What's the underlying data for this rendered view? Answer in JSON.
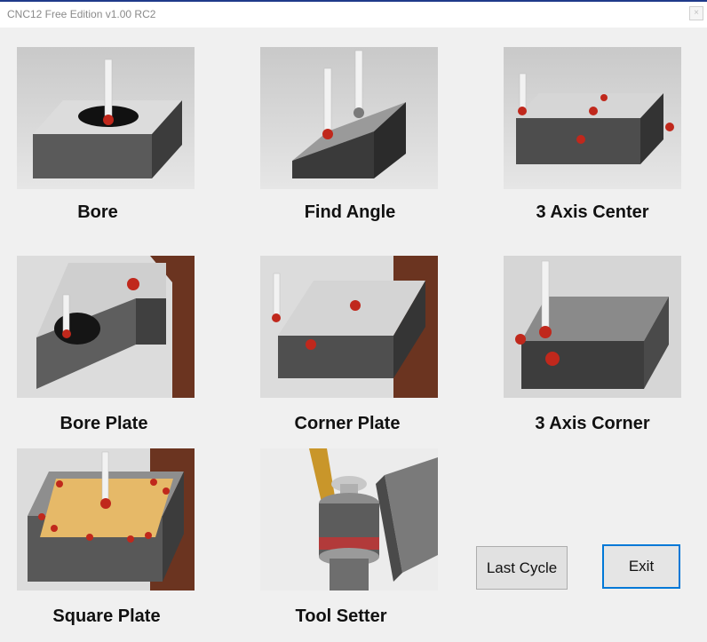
{
  "window": {
    "title": "CNC12 Free Edition v1.00 RC2",
    "close_glyph": "×"
  },
  "cycles": [
    {
      "label": "Bore",
      "icon": "bore-icon"
    },
    {
      "label": "Find Angle",
      "icon": "find-angle-icon"
    },
    {
      "label": "3 Axis Center",
      "icon": "three-axis-center-icon"
    },
    {
      "label": "Bore Plate",
      "icon": "bore-plate-icon"
    },
    {
      "label": "Corner Plate",
      "icon": "corner-plate-icon"
    },
    {
      "label": "3 Axis Corner",
      "icon": "three-axis-corner-icon"
    },
    {
      "label": "Square Plate",
      "icon": "square-plate-icon"
    },
    {
      "label": "Tool Setter",
      "icon": "tool-setter-icon"
    }
  ],
  "buttons": {
    "last_cycle": "Last Cycle",
    "exit": "Exit"
  },
  "colors": {
    "probe_ball": "#c0281c",
    "block": "#7a7a7a",
    "wood": "#6b3420",
    "accent": "#0078d7"
  }
}
